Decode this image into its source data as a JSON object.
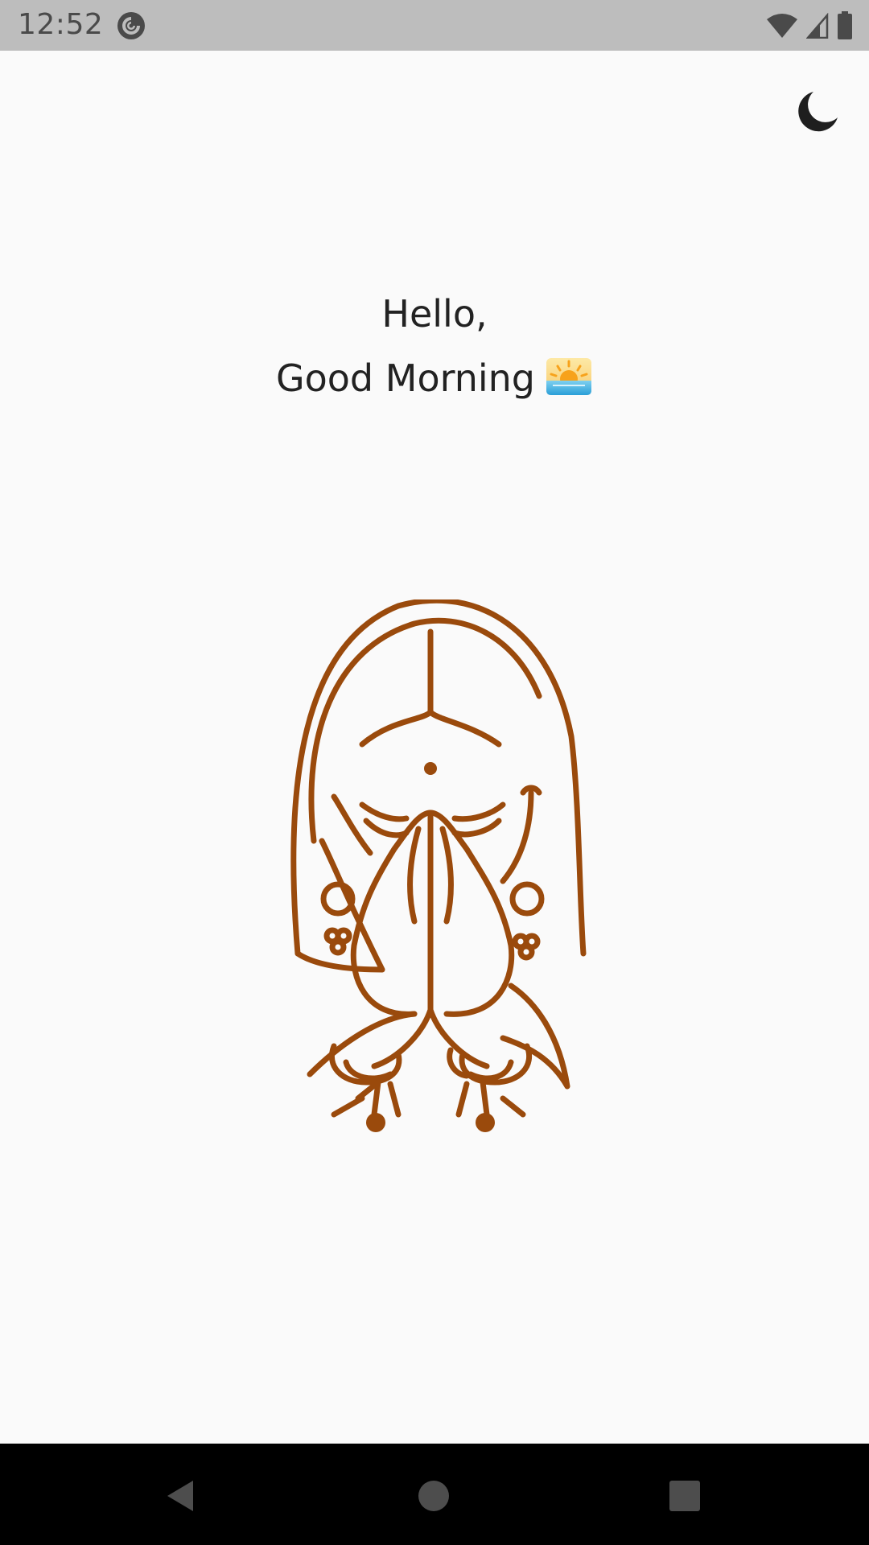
{
  "status_bar": {
    "time": "12:52",
    "app_icon": "pocket-casts-icon",
    "wifi_icon": "wifi-icon",
    "signal_icon": "cell-signal-icon",
    "battery_icon": "battery-icon"
  },
  "header": {
    "theme_toggle_icon": "moon-icon"
  },
  "greeting": {
    "line1": "Hello,",
    "line2": "Good Morning",
    "emoji_icon": "sunrise-icon"
  },
  "illustration": {
    "name": "namaste-woman-icon",
    "stroke_color": "#9a4a0c"
  },
  "nav_bar": {
    "back_icon": "back-triangle-icon",
    "home_icon": "home-circle-icon",
    "recents_icon": "recents-square-icon"
  },
  "colors": {
    "background": "#fafafa",
    "status_bar": "#bdbdbd",
    "nav_bar": "#000000",
    "text": "#222222",
    "accent": "#9a4a0c"
  }
}
